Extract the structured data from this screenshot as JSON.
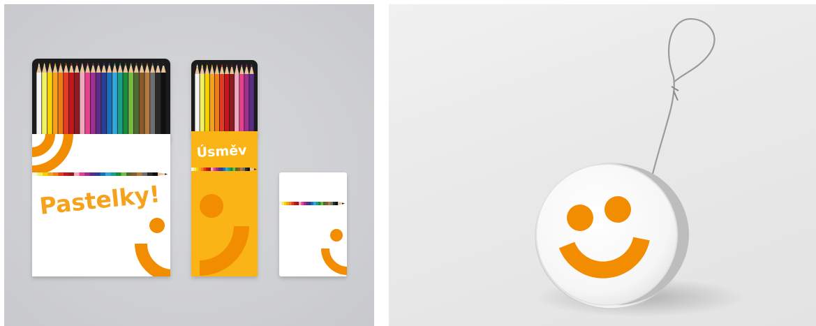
{
  "palette": {
    "orange": "#f28c00",
    "yellow": "#fbb414",
    "box_white": "#ffffff",
    "tray_black": "#1e1e1e"
  },
  "pencil_colors": [
    "#f4f4f4",
    "#f2f060",
    "#f7d100",
    "#f6a21a",
    "#ef7d1a",
    "#e53b23",
    "#c4161c",
    "#8e1b1f",
    "#f3a6c0",
    "#e8408d",
    "#9c2f8f",
    "#5b2d86",
    "#2c3d97",
    "#1d6fb8",
    "#32a7dc",
    "#18a08a",
    "#1b8b3c",
    "#79b843",
    "#4d6b2e",
    "#8b5a2b",
    "#b37a3e",
    "#6e6e6e",
    "#2a2a2a",
    "#101010"
  ],
  "boxes": {
    "large": {
      "title": "Pastelky!"
    },
    "tall": {
      "title": "Úsměv"
    }
  },
  "icons": {
    "smile": "smile-logo-icon",
    "yoyo": "yoyo-icon"
  }
}
